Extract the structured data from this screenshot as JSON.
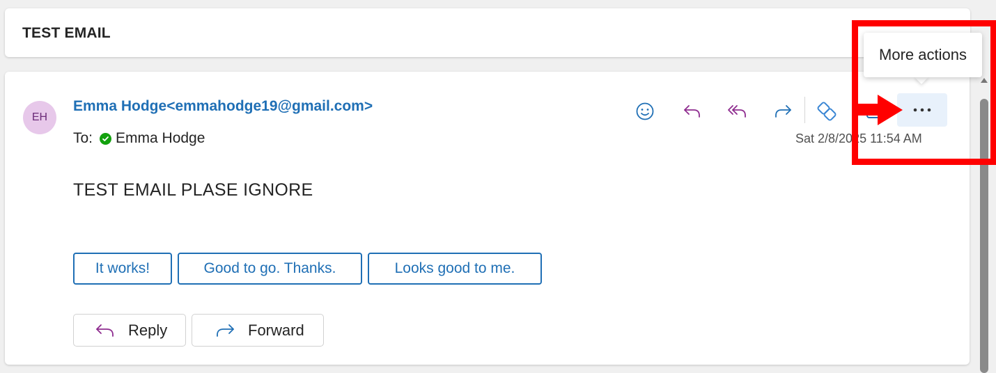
{
  "subject": {
    "title": "TEST EMAIL"
  },
  "message": {
    "avatar_initials": "EH",
    "sender": "Emma Hodge<emmahodge19@gmail.com>",
    "to_label": "To:",
    "recipient": "Emma Hodge",
    "timestamp": "Sat 2/8/2025 11:54 AM",
    "body": "TEST EMAIL PLASE IGNORE"
  },
  "quick_replies": [
    "It works!",
    "Good to go. Thanks.",
    "Looks good to me."
  ],
  "buttons": {
    "reply": "Reply",
    "forward": "Forward"
  },
  "toolbar_icons": [
    "emoji-icon",
    "reply-icon",
    "reply-all-icon",
    "forward-icon",
    "loop-icon",
    "app-icon",
    "more-actions-icon"
  ],
  "tooltip": {
    "text": "More actions"
  },
  "colors": {
    "accent": "#1f6fb5",
    "reply_purple": "#8e2c8f",
    "annotation": "#ff0000",
    "presence": "#13a10e"
  }
}
